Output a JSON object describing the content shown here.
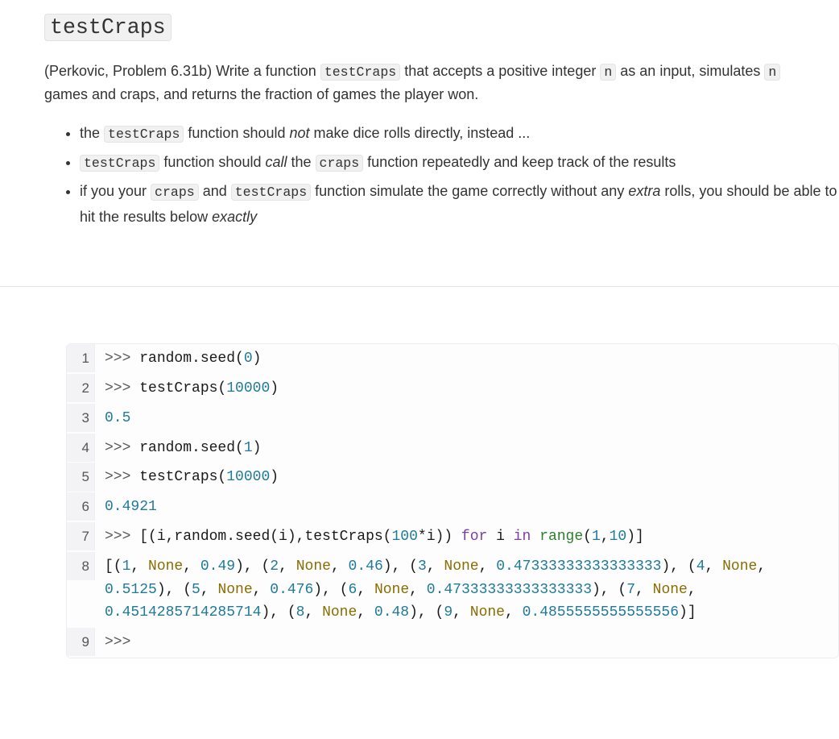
{
  "title_code": "testCraps",
  "intro_p1": "(Perkovic, Problem 6.31b)  Write a function ",
  "intro_code1": "testCraps",
  "intro_p2": " that accepts a positive integer ",
  "intro_code2": "n",
  "intro_p3": " as an input, simulates ",
  "intro_code3": "n",
  "intro_p4": " games and craps, and returns the fraction of games the player won.",
  "bullet1_a": "the ",
  "bullet1_code": "testCraps",
  "bullet1_b": " function should ",
  "bullet1_em": "not",
  "bullet1_c": " make dice rolls directly, instead ...",
  "bullet2_code1": "testCraps",
  "bullet2_a": " function should ",
  "bullet2_em": "call",
  "bullet2_b": " the ",
  "bullet2_code2": "craps",
  "bullet2_c": " function repeatedly and keep track of the results",
  "bullet3_a": "if you your ",
  "bullet3_code1": "craps",
  "bullet3_b": " and ",
  "bullet3_code2": "testCraps",
  "bullet3_c": " function simulate the game correctly without any ",
  "bullet3_em1": "extra",
  "bullet3_d": " rolls, you should be able to hit the results below ",
  "bullet3_em2": "exactly",
  "code": {
    "ln1": {
      "no": "1",
      "prompt": ">>> ",
      "t1": "random",
      "t2": ".seed(",
      "arg": "0",
      "t3": ")"
    },
    "ln2": {
      "no": "2",
      "prompt": ">>> ",
      "t1": "testCraps(",
      "arg": "10000",
      "t2": ")"
    },
    "ln3": {
      "no": "3",
      "out": "0.5"
    },
    "ln4": {
      "no": "4",
      "prompt": ">>> ",
      "t1": "random",
      "t2": ".seed(",
      "arg": "1",
      "t3": ")"
    },
    "ln5": {
      "no": "5",
      "prompt": ">>> ",
      "t1": "testCraps(",
      "arg": "10000",
      "t2": ")"
    },
    "ln6": {
      "no": "6",
      "out": "0.4921"
    },
    "ln7": {
      "no": "7",
      "prompt": ">>> ",
      "t1": "[(i,random.seed(i),testCraps(",
      "t2": "100",
      "t3": "*i)) ",
      "kw1": "for",
      "t4": " i ",
      "kw2": "in",
      "t5": " ",
      "bi": "range",
      "t6": "(",
      "a1": "1",
      "t7": ",",
      "a2": "10",
      "t8": ")]"
    },
    "ln8": {
      "no": "8",
      "p0": "[(",
      "n0": "1",
      "c0": ", ",
      "none0": "None",
      "c0b": ", ",
      "v0": "0.49",
      "c0c": "), (",
      "n1": "2",
      "c1": ", ",
      "none1": "None",
      "c1b": ", ",
      "v1": "0.46",
      "c1c": "), (",
      "n2": "3",
      "c2": ", ",
      "none2": "None",
      "c2b": ", ",
      "v2": "0.47333333333333333",
      "c2c": "), (",
      "n3": "4",
      "c3": ", ",
      "none3": "None",
      "c3b": ", ",
      "v3": "0.5125",
      "c3c": "), (",
      "n4": "5",
      "c4": ", ",
      "none4": "None",
      "c4b": ", ",
      "v4": "0.476",
      "c4c": "), (",
      "n5": "6",
      "c5": ", ",
      "none5": "None",
      "c5b": ", ",
      "v5": "0.47333333333333333",
      "c5c": "), (",
      "n6": "7",
      "c6": ", ",
      "none6": "None",
      "c6b": ", ",
      "v6": "0.4514285714285714",
      "c6c": "), (",
      "n7": "8",
      "c7": ", ",
      "none7": "None",
      "c7b": ", ",
      "v7": "0.48",
      "c7c": "), (",
      "n8": "9",
      "c8": ", ",
      "none8": "None",
      "c8b": ", ",
      "v8": "0.4855555555555556",
      "c8c": ")]"
    },
    "ln9": {
      "no": "9",
      "prompt": ">>>"
    }
  }
}
